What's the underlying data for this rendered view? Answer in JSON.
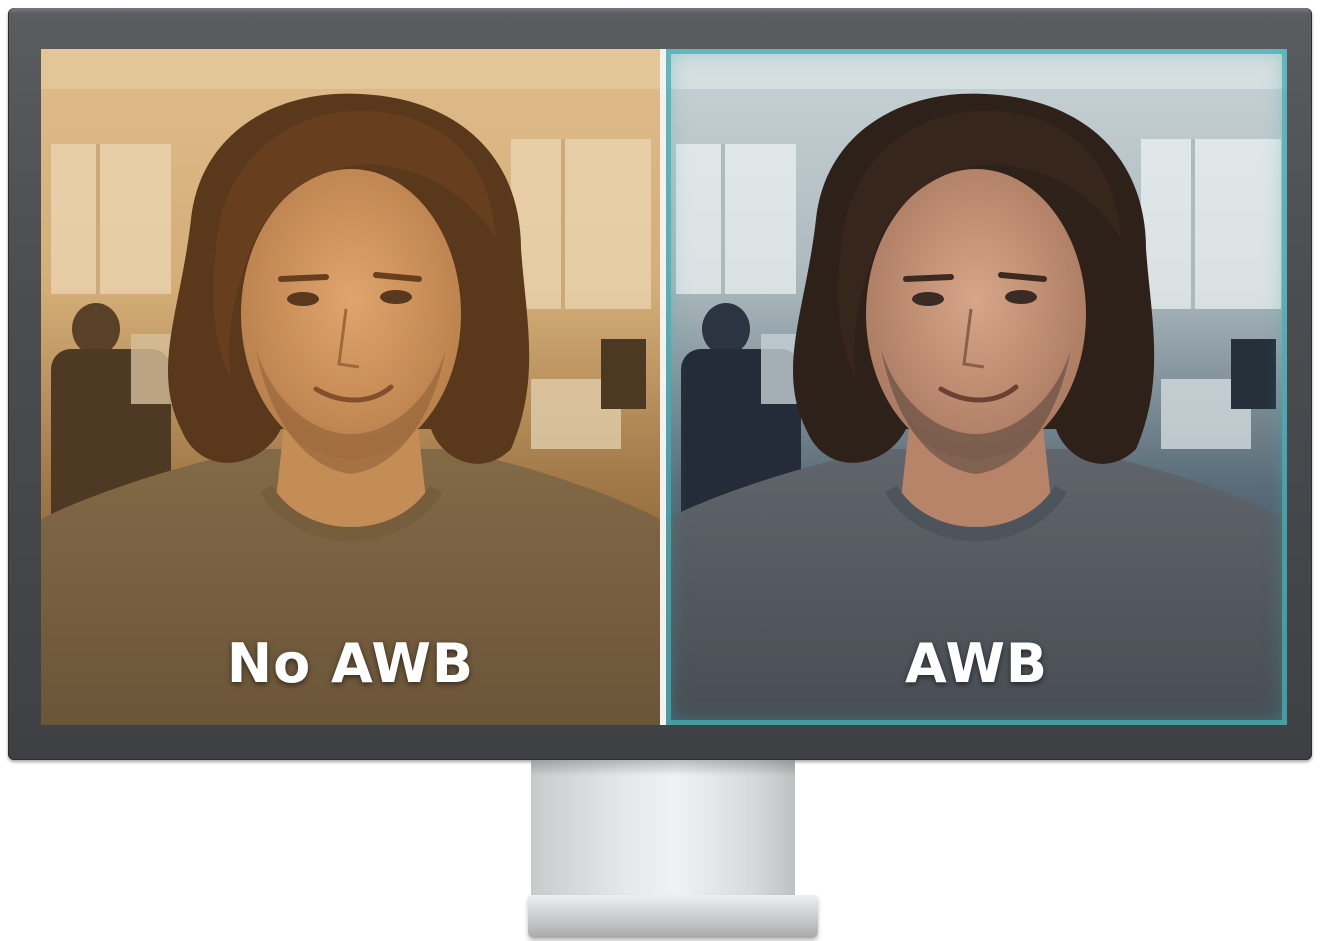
{
  "comparison": {
    "left": {
      "label": "No AWB"
    },
    "right": {
      "label": "AWB"
    }
  },
  "colors": {
    "bezel": "#4a4c50",
    "warm_tint": "#c8954f",
    "cool_tint": "#46afb4",
    "caption_text": "#ffffff",
    "stand": "#e6e7e9"
  },
  "icons": {
    "monitor": "monitor-icon"
  }
}
